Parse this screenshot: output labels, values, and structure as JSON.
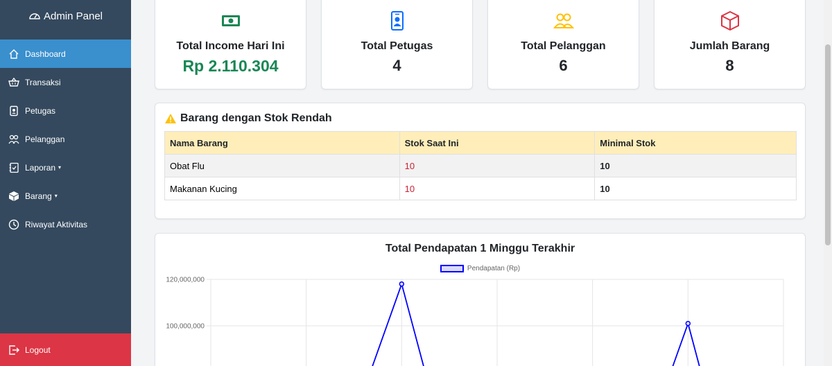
{
  "sidebar": {
    "brand": "Admin Panel",
    "items": [
      {
        "label": "Dashboard"
      },
      {
        "label": "Transaksi"
      },
      {
        "label": "Petugas"
      },
      {
        "label": "Pelanggan"
      },
      {
        "label": "Laporan",
        "caret": "▾"
      },
      {
        "label": "Barang",
        "caret": "▾"
      },
      {
        "label": "Riwayat Aktivitas"
      }
    ],
    "logout": "Logout"
  },
  "stats": [
    {
      "label": "Total Income Hari Ini",
      "value": "Rp 2.110.304"
    },
    {
      "label": "Total Petugas",
      "value": "4"
    },
    {
      "label": "Total Pelanggan",
      "value": "6"
    },
    {
      "label": "Jumlah Barang",
      "value": "8"
    }
  ],
  "stock": {
    "title": "Barang dengan Stok Rendah",
    "headers": [
      "Nama Barang",
      "Stok Saat Ini",
      "Minimal Stok"
    ],
    "rows": [
      [
        "Obat Flu",
        "10",
        "10"
      ],
      [
        "Makanan Kucing",
        "10",
        "10"
      ]
    ]
  },
  "colors": {
    "sidebar": "#34495e",
    "active": "#3a8fcd",
    "logout": "#dc3545",
    "income": "#198754",
    "line": "#0000ff"
  },
  "chart_data": {
    "type": "line",
    "title": "Total Pendapatan 1 Minggu Terakhir",
    "series": [
      {
        "name": "Pendapatan (Rp)",
        "values": [
          null,
          null,
          118000000,
          null,
          null,
          101000000,
          null
        ]
      }
    ],
    "y_ticks": [
      "120,000,000",
      "100,000,000"
    ],
    "y_tick_values": [
      120000000,
      100000000
    ],
    "grid": true,
    "legend": "top"
  }
}
